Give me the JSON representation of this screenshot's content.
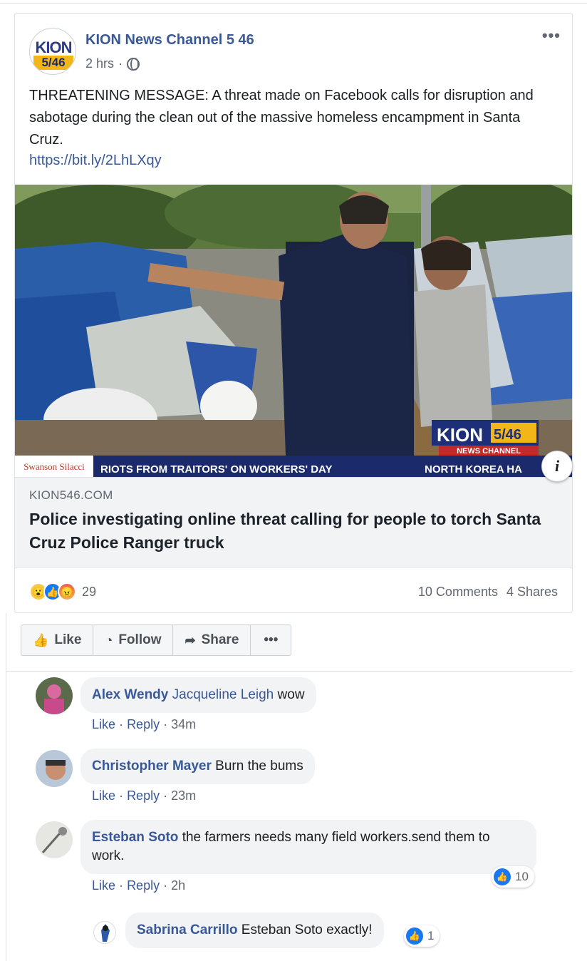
{
  "post": {
    "page_name": "KION News Channel 5 46",
    "avatar_kion": "KION",
    "avatar_num": "5/46",
    "time": "2 hrs",
    "text": "THREATENING MESSAGE: A threat made on Facebook calls for disruption and sabotage during the clean out of the massive homeless encampment in Santa Cruz.",
    "link": "https://bit.ly/2LhLXqy",
    "more_icon": "•••"
  },
  "image": {
    "bug_kion": "KION",
    "bug_num": "5/46",
    "bug_sub": "NEWS CHANNEL",
    "ticker_left": "RIOTS FROM TRAITORS' ON WORKERS' DAY",
    "ticker_right": "NORTH KOREA HA",
    "ticker_logo": "Swanson Silacci"
  },
  "attachment": {
    "domain": "KION546.COM",
    "headline": "Police investigating online threat calling for people to torch Santa Cruz Police Ranger truck"
  },
  "stats": {
    "reaction_count": "29",
    "comments": "10 Comments",
    "shares": "4 Shares"
  },
  "actions": {
    "like": "Like",
    "follow": "Follow",
    "share": "Share",
    "more": "•••"
  },
  "comments": [
    {
      "name": "Alex Wendy",
      "tag": "Jacqueline Leigh",
      "text": "wow",
      "time": "34m"
    },
    {
      "name": "Christopher Mayer",
      "tag": "",
      "text": "Burn the bums",
      "time": "23m"
    },
    {
      "name": "Esteban Soto",
      "tag": "",
      "text": "the farmers needs many field workers.send them to work.",
      "time": "2h",
      "likes": "10"
    },
    {
      "name": "Sabrina Carrillo",
      "tag": "Esteban Soto",
      "text": "exactly!",
      "likes": "1"
    }
  ],
  "comment_actions": {
    "like": "Like",
    "reply": "Reply"
  },
  "colors": {
    "link": "#385898",
    "like_blue": "#1877f2",
    "meta_gray": "#606770"
  }
}
